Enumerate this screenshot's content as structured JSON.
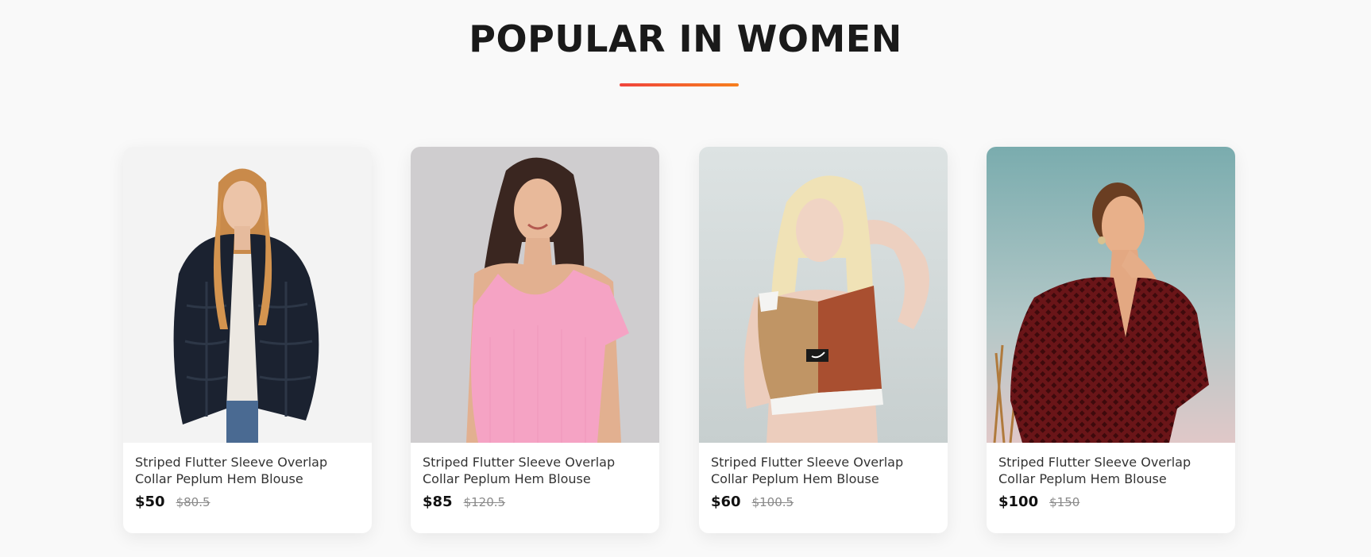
{
  "section": {
    "title": "POPULAR IN WOMEN"
  },
  "products": [
    {
      "name": "Striped Flutter Sleeve Overlap Collar Peplum Hem Blouse",
      "new_price": "$50",
      "old_price": "$80.5",
      "image_desc": "woman in dark navy fur jacket"
    },
    {
      "name": "Striped Flutter Sleeve Overlap Collar Peplum Hem Blouse",
      "new_price": "$85",
      "old_price": "$120.5",
      "image_desc": "woman in pink top"
    },
    {
      "name": "Striped Flutter Sleeve Overlap Collar Peplum Hem Blouse",
      "new_price": "$60",
      "old_price": "$100.5",
      "image_desc": "woman in tan and rust sports top"
    },
    {
      "name": "Striped Flutter Sleeve Overlap Collar Peplum Hem Blouse",
      "new_price": "$100",
      "old_price": "$150",
      "image_desc": "woman in burgundy patterned blouse"
    }
  ],
  "colors": {
    "accent_start": "#f0443c",
    "accent_end": "#f77f1e",
    "background": "#f9f9f9"
  }
}
